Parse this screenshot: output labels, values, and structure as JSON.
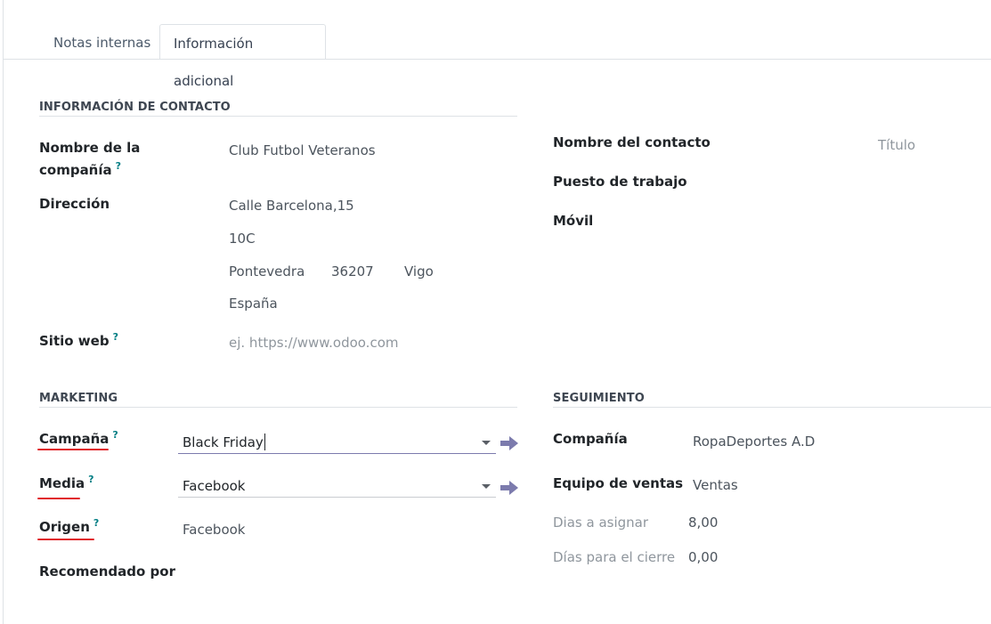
{
  "tabs": [
    {
      "label": "Notas internas",
      "active": false
    },
    {
      "label": "Información adicional",
      "active": true
    }
  ],
  "contact_section": {
    "title": "INFORMACIÓN DE CONTACTO",
    "company_name_label_1": "Nombre de la",
    "company_name_label_2": "compañía",
    "company_name": "Club Futbol Veteranos",
    "address_label": "Dirección",
    "street": "Calle Barcelona,15",
    "street2": "10C",
    "state": "Pontevedra",
    "zip": "36207",
    "city": "Vigo",
    "country": "España",
    "website_label": "Sitio web",
    "website_placeholder": "ej. https://www.odoo.com"
  },
  "contact_right": {
    "contact_name_label": "Nombre del contacto",
    "title_placeholder": "Título",
    "job_position_label": "Puesto de trabajo",
    "mobile_label": "Móvil"
  },
  "marketing": {
    "title": "MARKETING",
    "campaign_label": "Campaña",
    "campaign_value": "Black Friday",
    "medium_label": "Media",
    "medium_value": "Facebook",
    "source_label": "Origen",
    "source_value": "Facebook",
    "referred_label": "Recomendado por"
  },
  "tracking": {
    "title": "SEGUIMIENTO",
    "company_label": "Compañía",
    "company_value": "RopaDeportes A.D",
    "sales_team_label": "Equipo de ventas",
    "sales_team_value": "Ventas",
    "days_assign_label": "Dias a asignar",
    "days_assign_value": "8,00",
    "days_close_label": "Días para el cierre",
    "days_close_value": "0,00"
  },
  "help_mark": "?",
  "colors": {
    "accent": "#7c7bad",
    "help": "#017e84",
    "annotation": "#e0222b"
  }
}
